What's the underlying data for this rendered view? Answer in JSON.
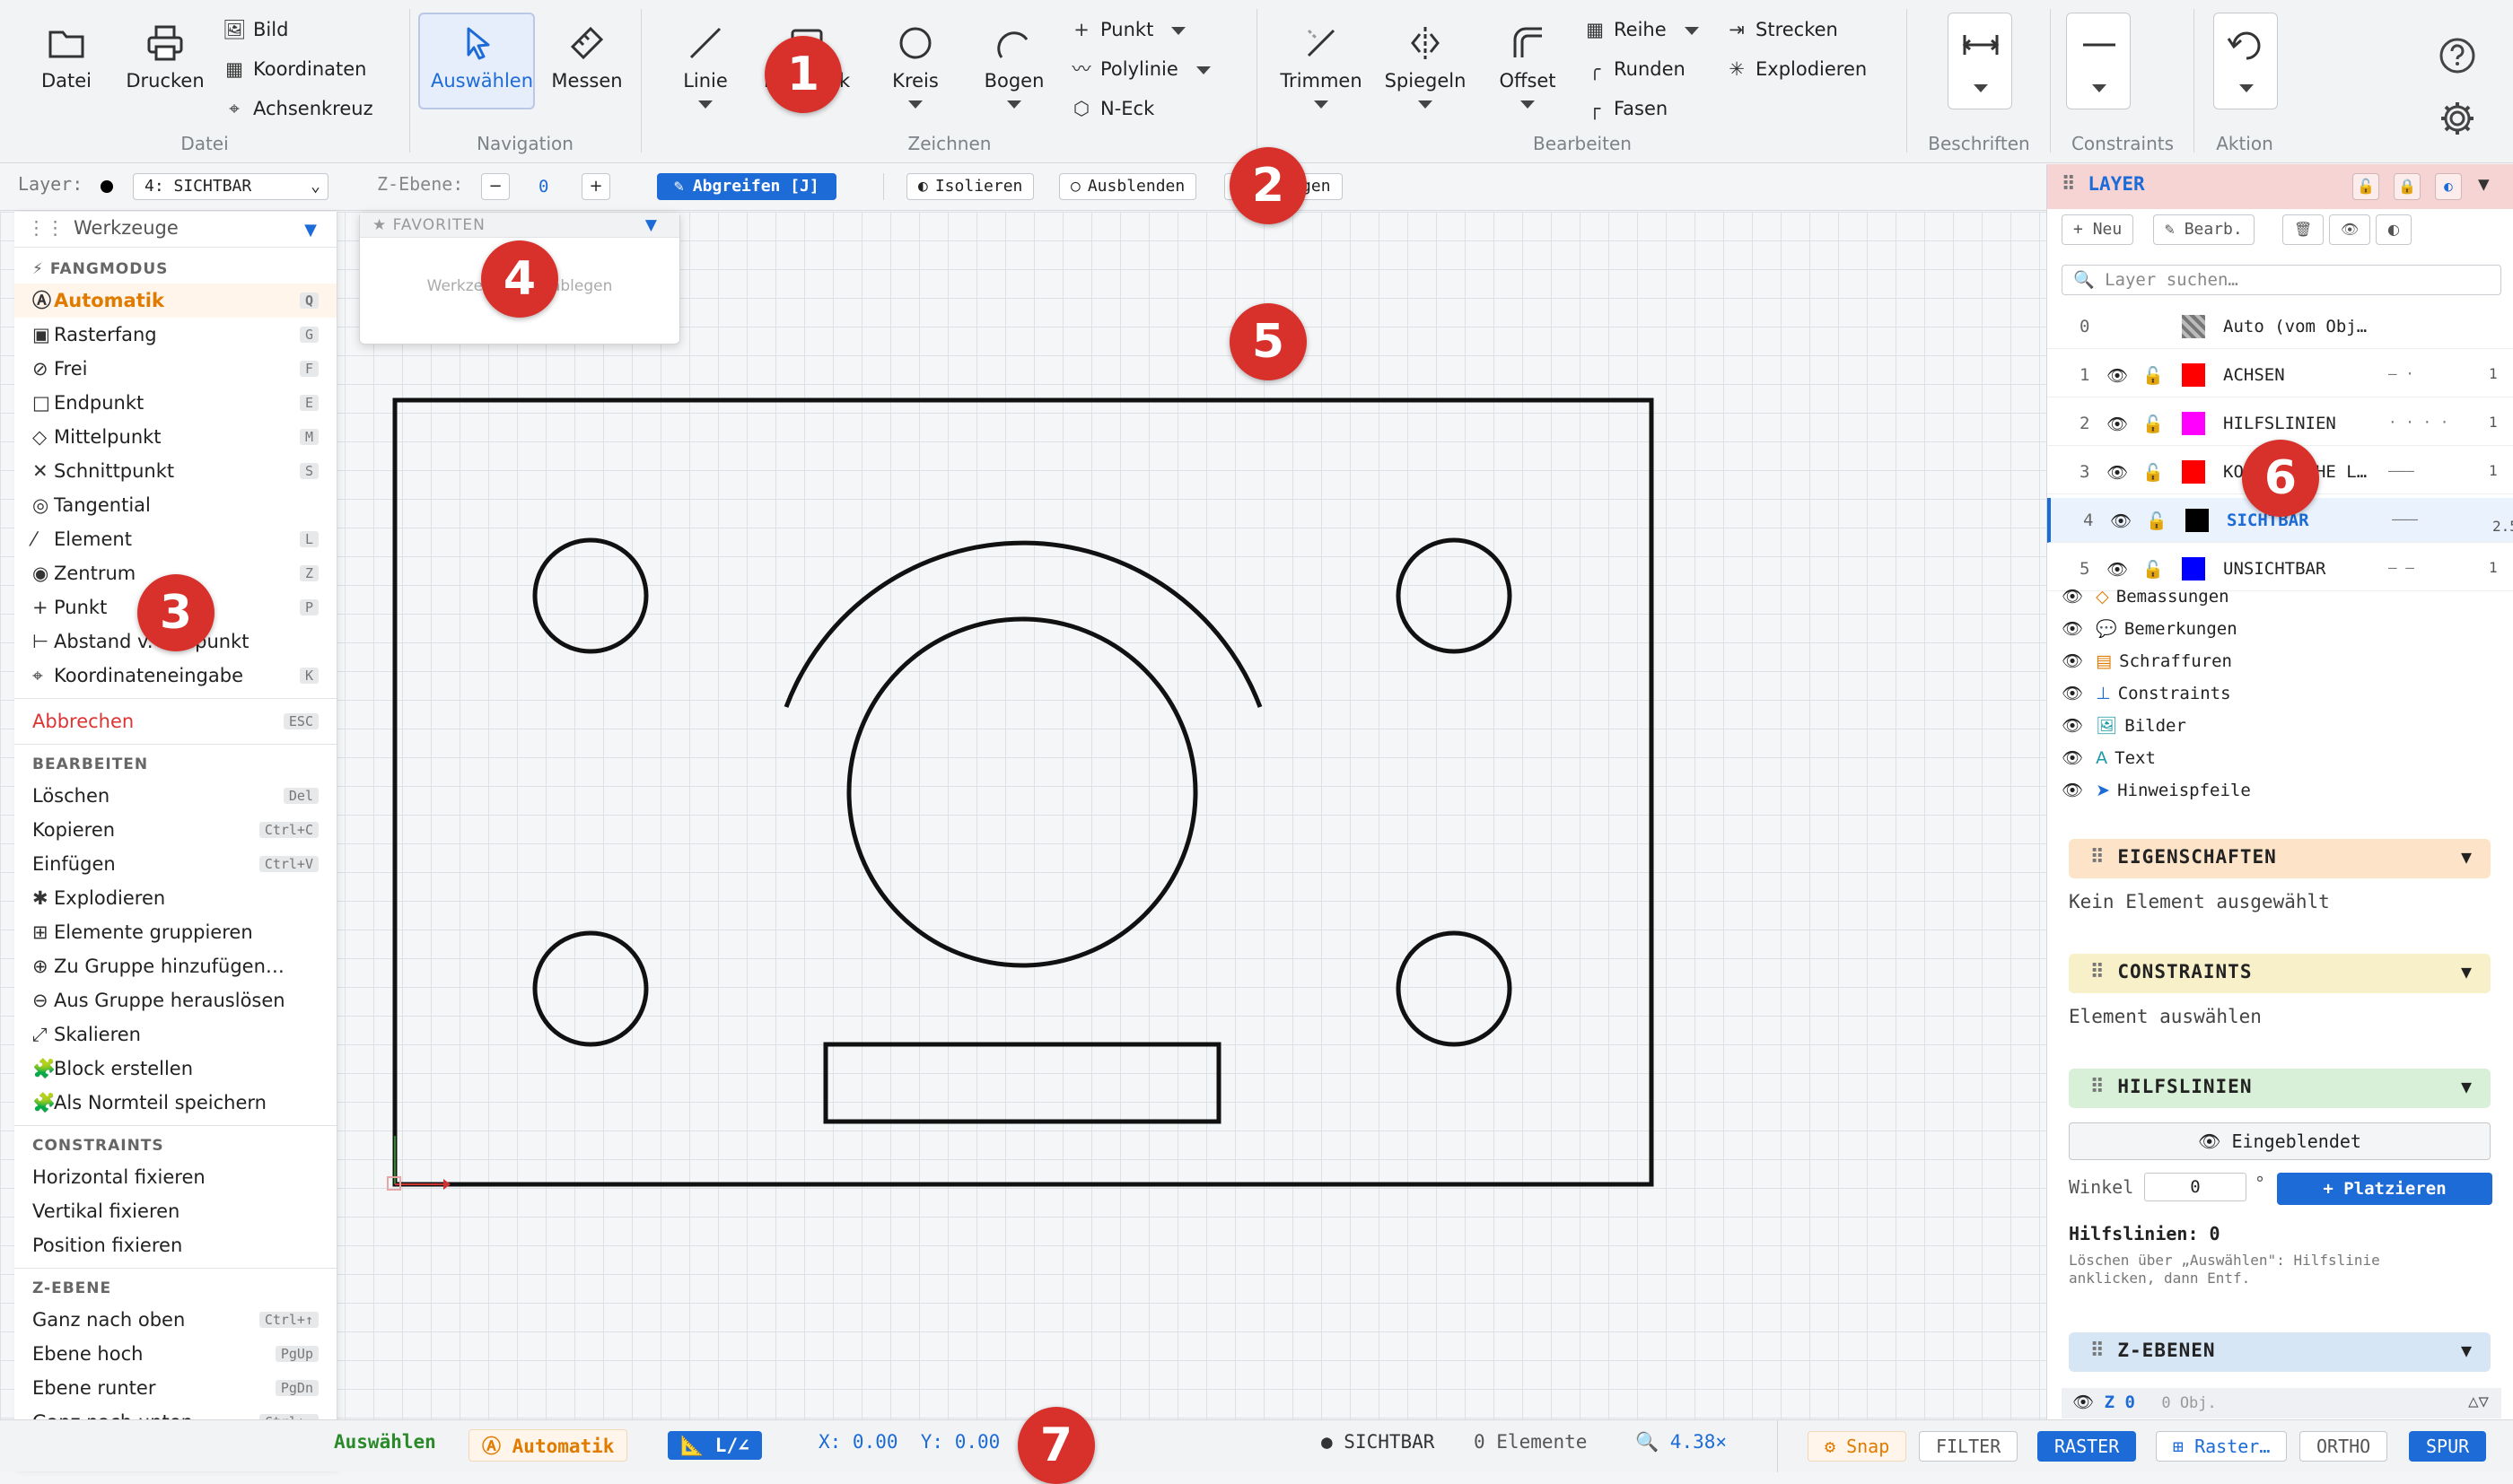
{
  "ribbon": {
    "datei": {
      "label": "Datei",
      "open": "Datei",
      "print": "Drucken",
      "bild": "Bild",
      "koordinaten": "Koordinaten",
      "achsenkreuz": "Achsenkreuz"
    },
    "navigation": {
      "label": "Navigation",
      "select": "Auswählen",
      "measure": "Messen"
    },
    "zeichnen": {
      "label": "Zeichnen",
      "linie": "Linie",
      "rechteck": "Rechteck",
      "kreis": "Kreis",
      "bogen": "Bogen",
      "punkt": "Punkt",
      "polylinie": "Polylinie",
      "neck": "N-Eck"
    },
    "bearbeiten": {
      "label": "Bearbeiten",
      "trimmen": "Trimmen",
      "spiegeln": "Spiegeln",
      "offset": "Offset",
      "reihe": "Reihe",
      "runden": "Runden",
      "fasen": "Fasen",
      "strecken": "Strecken",
      "explodieren": "Explodieren"
    },
    "beschriften": {
      "label": "Beschriften"
    },
    "constraints": {
      "label": "Constraints"
    },
    "aktion": {
      "label": "Aktion"
    }
  },
  "layerbar": {
    "layer_label": "Layer:",
    "layer_value": "4: SICHTBAR",
    "zebene_label": "Z-Ebene:",
    "zebene_minus": "−",
    "zebene_value": "0",
    "zebene_plus": "+",
    "abgreifen": "Abgreifen [J]",
    "isolieren": "Isolieren",
    "ausblenden": "Ausblenden",
    "anzeigen": "Anzeigen"
  },
  "tools": {
    "title": "Werkzeuge",
    "fangmodus_head": "FANGMODUS",
    "fangmodus": [
      {
        "icon": "Ⓐ",
        "label": "Automatik",
        "key": "Q"
      },
      {
        "icon": "▣",
        "label": "Rasterfang",
        "key": "G"
      },
      {
        "icon": "⊘",
        "label": "Frei",
        "key": "F"
      },
      {
        "icon": "□",
        "label": "Endpunkt",
        "key": "E"
      },
      {
        "icon": "◇",
        "label": "Mittelpunkt",
        "key": "M"
      },
      {
        "icon": "✕",
        "label": "Schnittpunkt",
        "key": "S"
      },
      {
        "icon": "◎",
        "label": "Tangential",
        "key": ""
      },
      {
        "icon": "⁄",
        "label": "Element",
        "key": "L"
      },
      {
        "icon": "◉",
        "label": "Zentrum",
        "key": "Z"
      },
      {
        "icon": "+",
        "label": "Punkt",
        "key": "P"
      },
      {
        "icon": "⊢",
        "label": "Abstand v. Endpunkt",
        "key": ""
      },
      {
        "icon": "⌖",
        "label": "Koordinateneingabe",
        "key": "K"
      }
    ],
    "abbrechen": "Abbrechen",
    "abbrechen_key": "ESC",
    "bearbeiten_head": "BEARBEITEN",
    "bearbeiten": [
      {
        "icon": "",
        "label": "Löschen",
        "key": "Del"
      },
      {
        "icon": "",
        "label": "Kopieren",
        "key": "Ctrl+C"
      },
      {
        "icon": "",
        "label": "Einfügen",
        "key": "Ctrl+V"
      },
      {
        "icon": "✱",
        "label": "Explodieren",
        "key": ""
      },
      {
        "icon": "⊞",
        "label": "Elemente gruppieren",
        "key": ""
      },
      {
        "icon": "⊕",
        "label": "Zu Gruppe hinzufügen…",
        "key": ""
      },
      {
        "icon": "⊖",
        "label": "Aus Gruppe herauslösen",
        "key": ""
      },
      {
        "icon": "⤢",
        "label": "Skalieren",
        "key": ""
      },
      {
        "icon": "🧩",
        "label": "Block erstellen",
        "key": ""
      },
      {
        "icon": "🧩",
        "label": "Als Normteil speichern",
        "key": ""
      }
    ],
    "constraints_head": "CONSTRAINTS",
    "constraints": [
      {
        "label": "Horizontal fixieren"
      },
      {
        "label": "Vertikal fixieren"
      },
      {
        "label": "Position fixieren"
      }
    ],
    "zebene_head": "Z-EBENE",
    "zebene": [
      {
        "label": "Ganz nach oben",
        "key": "Ctrl+↑"
      },
      {
        "label": "Ebene hoch",
        "key": "PgUp"
      },
      {
        "label": "Ebene runter",
        "key": "PgDn"
      },
      {
        "label": "Ganz nach unten",
        "key": "Ctrl+↓"
      }
    ]
  },
  "favorites": {
    "title": "FAVORITEN",
    "hint": "Werkzeuge hier ablegen"
  },
  "layers": {
    "title": "LAYER",
    "new": "Neu",
    "edit": "Bearb.",
    "search_placeholder": "Layer suchen…",
    "rows": [
      {
        "num": "0",
        "name": "Auto (vom Obj…",
        "color": "#8a8a8a",
        "width": ""
      },
      {
        "num": "1",
        "name": "ACHSEN",
        "color": "#ff0000",
        "width": "1"
      },
      {
        "num": "2",
        "name": "HILFSLINIEN",
        "color": "#ff00ff",
        "width": "1"
      },
      {
        "num": "3",
        "name": "KOSMETISCHE L…",
        "color": "#ff0000",
        "width": "1"
      },
      {
        "num": "4",
        "name": "SICHTBAR",
        "color": "#000000",
        "width": "2.5"
      },
      {
        "num": "5",
        "name": "UNSICHTBAR",
        "color": "#0000ff",
        "width": "1"
      }
    ],
    "visibility": [
      {
        "icon": "◇",
        "label": "Bemassungen",
        "color": "#e07b00"
      },
      {
        "icon": "💬",
        "label": "Bemerkungen",
        "color": "#555"
      },
      {
        "icon": "▤",
        "label": "Schraffuren",
        "color": "#e07b00"
      },
      {
        "icon": "⊥",
        "label": "Constraints",
        "color": "#1c6bd6"
      },
      {
        "icon": "🖼",
        "label": "Bilder",
        "color": "#1b9aa8"
      },
      {
        "icon": "A",
        "label": "Text",
        "color": "#1b9aa8"
      },
      {
        "icon": "➤",
        "label": "Hinweispfeile",
        "color": "#1c6bd6"
      }
    ]
  },
  "properties": {
    "title": "EIGENSCHAFTEN",
    "text": "Kein Element ausgewählt"
  },
  "constraints_panel": {
    "title": "CONSTRAINTS",
    "text": "Element auswählen"
  },
  "hilfslinien": {
    "title": "HILFSLINIEN",
    "toggle": "Eingeblendet",
    "winkel_label": "Winkel",
    "winkel_value": "0",
    "unit": "°",
    "place": "+ Platzieren",
    "count_label": "Hilfslinien:",
    "count": "0",
    "hint1": "Löschen über „Auswählen\": Hilfslinie",
    "hint2": "anklicken, dann Entf."
  },
  "zebenen": {
    "title": "Z-EBENEN",
    "z0": "Z 0",
    "z0_count": "0 Obj."
  },
  "status": {
    "tool": "Auswählen",
    "snap_mode": "Automatik",
    "angle_mode": "L/∠",
    "coords": "X: 0.00  Y: 0.00",
    "layer": "SICHTBAR",
    "elements": "0 Elemente",
    "zoom": "4.38×",
    "snap": "Snap",
    "filter": "FILTER",
    "raster": "RASTER",
    "raster_opt": "Raster…",
    "ortho": "ORTHO",
    "spur": "SPUR"
  },
  "markers": [
    "1",
    "2",
    "3",
    "4",
    "5",
    "6",
    "7"
  ],
  "colors": {
    "accent": "#1c6bd6",
    "marker": "#d8302a",
    "auto_orange": "#e07b00"
  }
}
